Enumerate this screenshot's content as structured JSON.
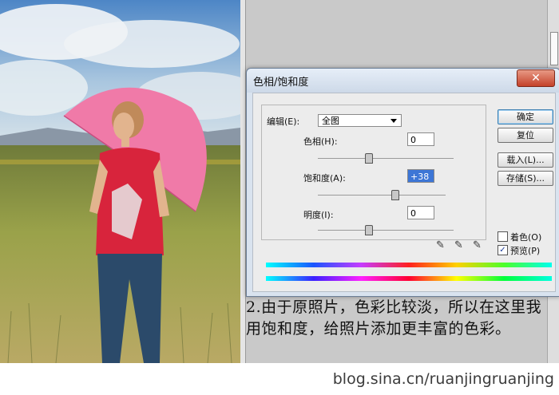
{
  "dialog": {
    "title": "色相/饱和度",
    "close_label": "✕",
    "edit": {
      "label": "编辑(E):",
      "value": "全图"
    },
    "hue": {
      "label": "色相(H):",
      "value": "0"
    },
    "saturation": {
      "label": "饱和度(A):",
      "value": "+38"
    },
    "lightness": {
      "label": "明度(I):",
      "value": "0"
    },
    "buttons": {
      "ok": "确定",
      "reset": "复位",
      "load": "载入(L)...",
      "save": "存储(S)..."
    },
    "colorize": {
      "label": "着色(O)",
      "checked": false
    },
    "preview": {
      "label": "预览(P)",
      "checked": true,
      "mark": "✓"
    }
  },
  "caption": "2.由于原照片，色彩比较淡，所以在这里我用饱和度，给照片添加更丰富的色彩。",
  "watermark": "blog.sina.cn/ruanjingruanjing",
  "colors": {
    "umbrella": "#f07aa8",
    "shirt": "#d8243c",
    "jeans": "#2b4a6a",
    "sky": "#5a8ec8",
    "grass": "#8a9a3a"
  }
}
